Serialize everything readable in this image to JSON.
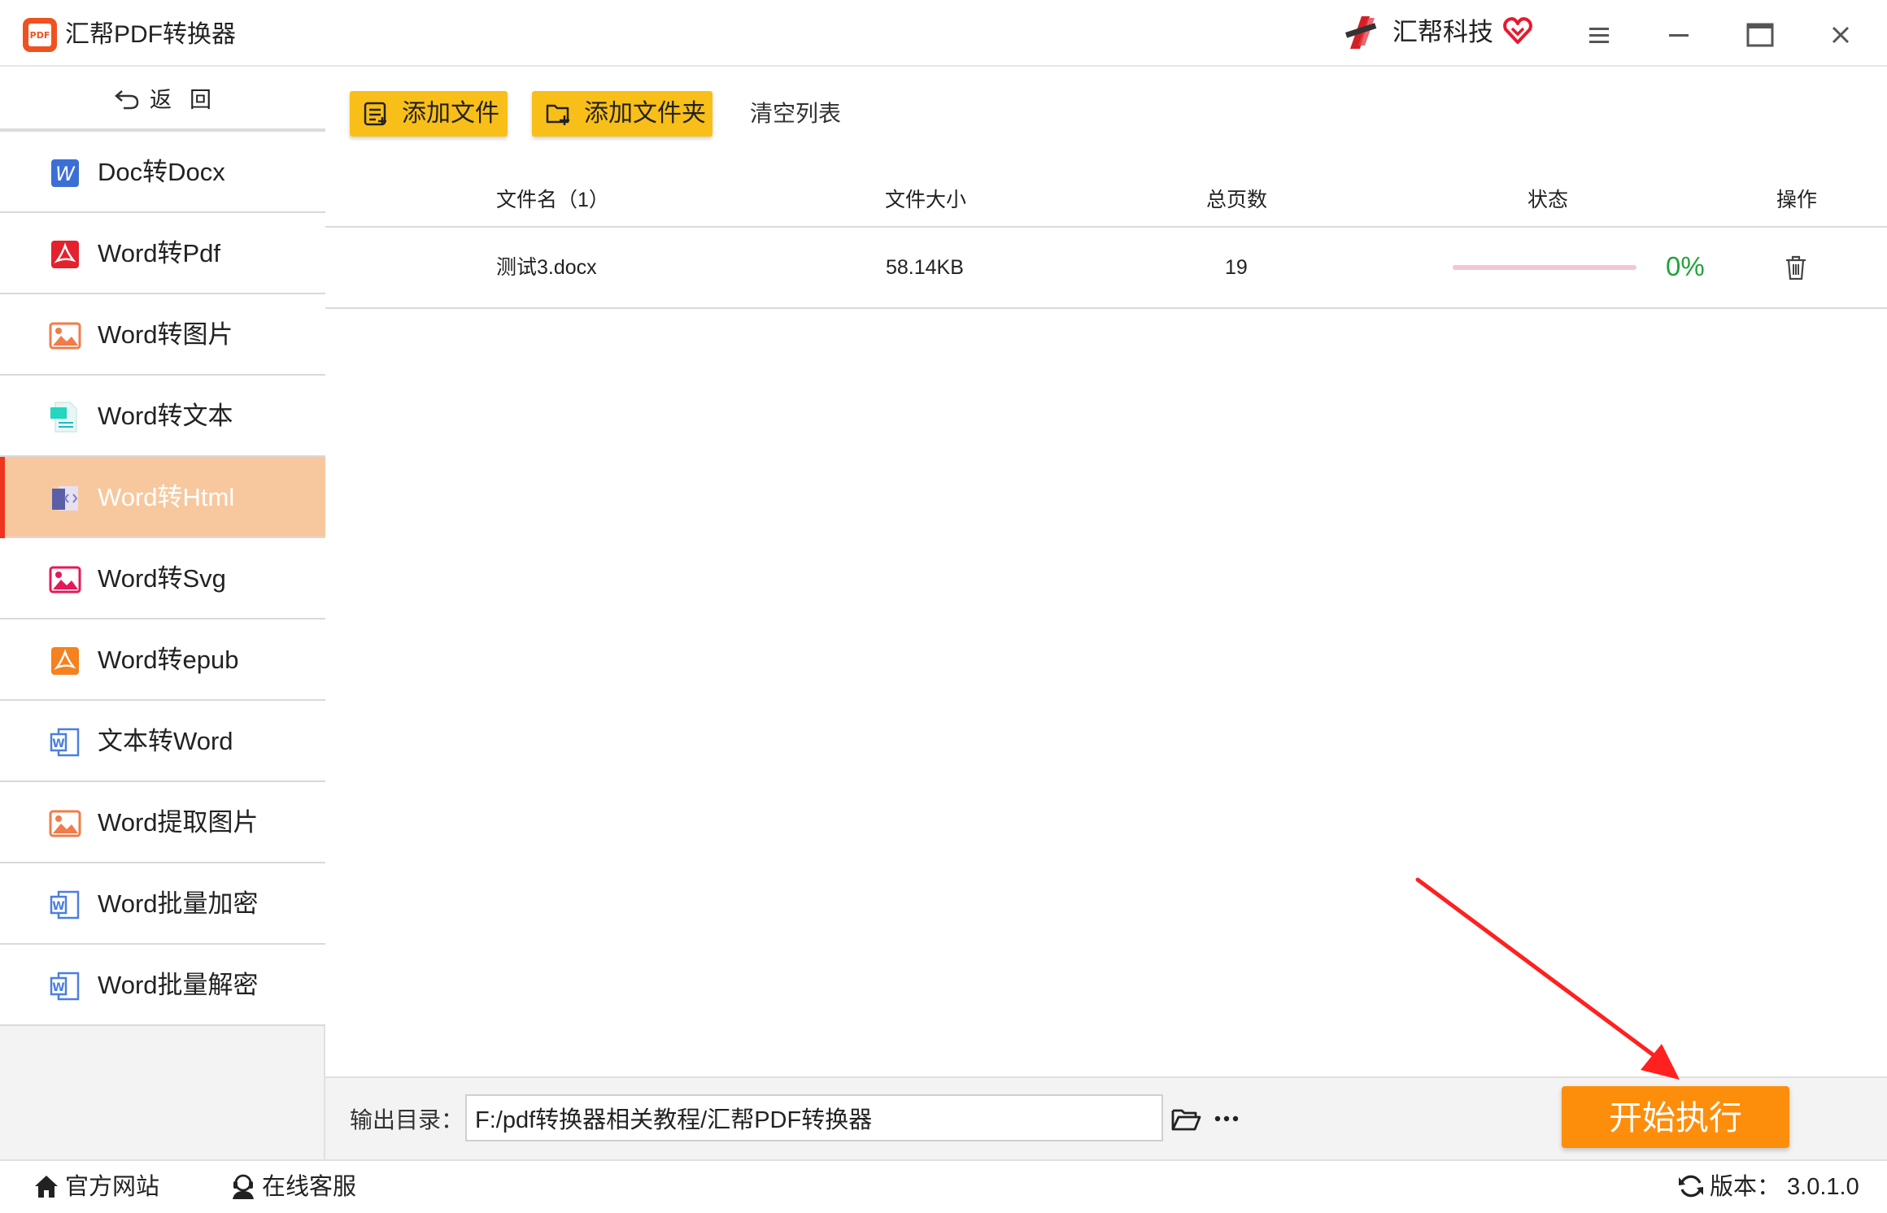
{
  "app": {
    "title": "汇帮PDF转换器",
    "logo_text": "PDF"
  },
  "brand": {
    "name": "汇帮科技"
  },
  "colors": {
    "accent": "#f9bf19",
    "active_nav": "#f7c89e",
    "start_button": "#fd8e0c",
    "progress_text": "#22a33a",
    "arrow": "#ff2020"
  },
  "sidebar": {
    "back_label": "返回",
    "items": [
      {
        "label": "Doc转Docx",
        "icon": "word-blue-icon"
      },
      {
        "label": "Word转Pdf",
        "icon": "pdf-red-icon"
      },
      {
        "label": "Word转图片",
        "icon": "image-orange-icon"
      },
      {
        "label": "Word转文本",
        "icon": "text-doc-teal-icon"
      },
      {
        "label": "Word转Html",
        "icon": "html-doc-icon"
      },
      {
        "label": "Word转Svg",
        "icon": "image-pink-icon"
      },
      {
        "label": "Word转epub",
        "icon": "epub-orange-icon"
      },
      {
        "label": "文本转Word",
        "icon": "word-outline-icon"
      },
      {
        "label": "Word提取图片",
        "icon": "image-orange-icon"
      },
      {
        "label": "Word批量加密",
        "icon": "word-outline-icon"
      },
      {
        "label": "Word批量解密",
        "icon": "word-outline-icon"
      }
    ],
    "active_index": 4
  },
  "toolbar": {
    "add_file": "添加文件",
    "add_folder": "添加文件夹",
    "clear_list": "清空列表"
  },
  "table": {
    "headers": {
      "name": "文件名（1）",
      "size": "文件大小",
      "pages": "总页数",
      "status": "状态",
      "action": "操作"
    },
    "rows": [
      {
        "name": "测试3.docx",
        "size": "58.14KB",
        "pages": "19",
        "progress": 0,
        "progress_text": "0%"
      }
    ]
  },
  "output": {
    "label": "输出目录：",
    "path": "F:/pdf转换器相关教程/汇帮PDF转换器"
  },
  "start_button": "开始执行",
  "statusbar": {
    "website": "官方网站",
    "service": "在线客服",
    "version": "版本：  3.0.1.0"
  }
}
